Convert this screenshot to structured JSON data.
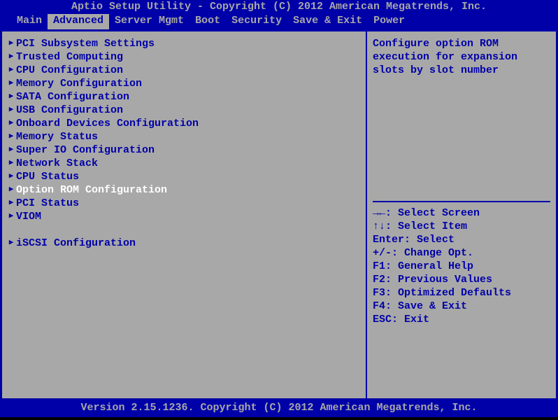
{
  "title": "Aptio Setup Utility - Copyright (C) 2012 American Megatrends, Inc.",
  "tabs": [
    {
      "label": "Main"
    },
    {
      "label": "Advanced"
    },
    {
      "label": "Server Mgmt"
    },
    {
      "label": "Boot"
    },
    {
      "label": "Security"
    },
    {
      "label": "Save & Exit"
    },
    {
      "label": "Power"
    }
  ],
  "active_tab": "Advanced",
  "items": [
    {
      "label": "PCI Subsystem Settings"
    },
    {
      "label": "Trusted Computing"
    },
    {
      "label": "CPU Configuration"
    },
    {
      "label": "Memory Configuration"
    },
    {
      "label": "SATA Configuration"
    },
    {
      "label": "USB Configuration"
    },
    {
      "label": "Onboard Devices Configuration"
    },
    {
      "label": "Memory Status"
    },
    {
      "label": "Super IO Configuration"
    },
    {
      "label": "Network Stack"
    },
    {
      "label": "CPU Status"
    },
    {
      "label": "Option ROM Configuration"
    },
    {
      "label": "PCI Status"
    },
    {
      "label": "VIOM"
    }
  ],
  "selected_item": "Option ROM Configuration",
  "extra_items": [
    {
      "label": "iSCSI Configuration"
    }
  ],
  "help_text": "Configure option ROM execution for expansion slots by slot number",
  "keys": {
    "screen_icon": "→←",
    "screen": ": Select Screen",
    "item_icon": "↑↓",
    "item": ": Select Item",
    "enter": "Enter: Select",
    "change": "+/-: Change Opt.",
    "f1": "F1: General Help",
    "f2": "F2: Previous Values",
    "f3": "F3: Optimized Defaults",
    "f4": "F4: Save & Exit",
    "esc": "ESC: Exit"
  },
  "footer": "Version 2.15.1236. Copyright (C) 2012 American Megatrends, Inc."
}
